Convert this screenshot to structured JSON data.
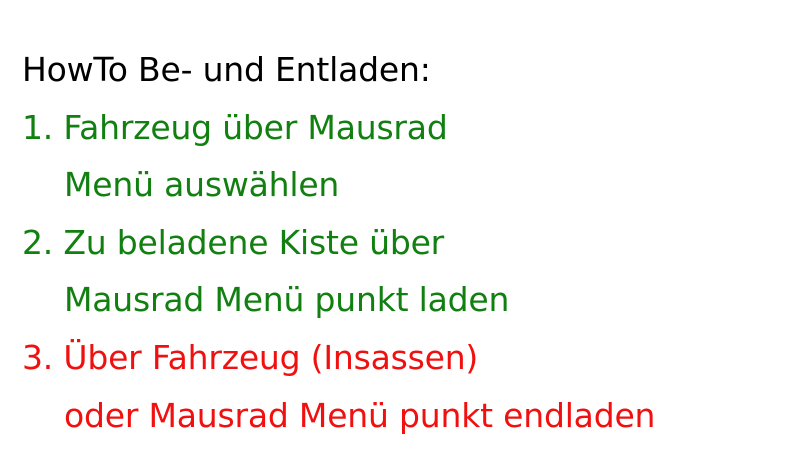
{
  "heading": "HowTo Be- und Entladen:",
  "steps": [
    {
      "line1": "1. Fahrzeug über Mausrad",
      "line2": "Menü auswählen",
      "color": "#118011"
    },
    {
      "line1": "2. Zu beladene Kiste über",
      "line2": "Mausrad Menü punkt laden",
      "color": "#118011"
    },
    {
      "line1": "3. Über Fahrzeug (Insassen)",
      "line2": "oder Mausrad Menü punkt endladen",
      "color": "#f01010"
    }
  ]
}
